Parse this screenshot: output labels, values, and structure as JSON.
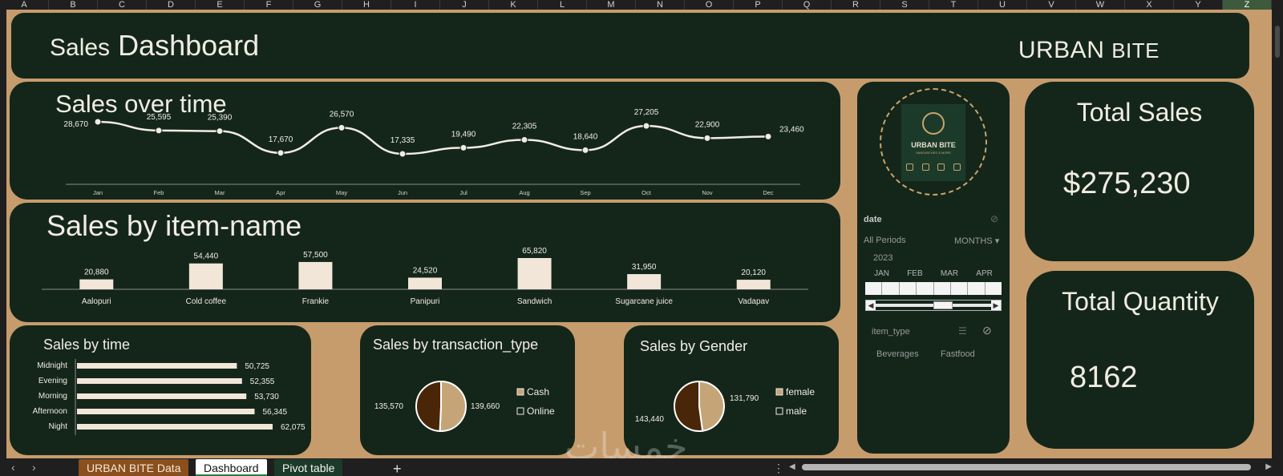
{
  "columns": [
    "A",
    "B",
    "C",
    "D",
    "E",
    "F",
    "G",
    "H",
    "I",
    "J",
    "K",
    "L",
    "M",
    "N",
    "O",
    "P",
    "Q",
    "R",
    "S",
    "T",
    "U",
    "V",
    "W",
    "X",
    "Y",
    "Z"
  ],
  "header": {
    "title_word_1": "Sales",
    "title_word_2": "Dashboard",
    "brand_word_1": "URBAN",
    "brand_word_2": "BITE"
  },
  "panels": {
    "sales_over_time": "Sales over time",
    "sales_by_item": "Sales by item-name",
    "sales_by_time": "Sales by time",
    "sales_by_transaction": "Sales by transaction_type",
    "sales_by_gender": "Sales by Gender"
  },
  "logo": {
    "name": "URBAN BITE",
    "tagline": "SANDWICHES & MORE"
  },
  "slicers": {
    "date": {
      "label": "date",
      "all_periods": "All Periods",
      "level": "MONTHS",
      "year": "2023",
      "months": [
        "JAN",
        "FEB",
        "MAR",
        "APR"
      ]
    },
    "item_type": {
      "label": "item_type",
      "items": [
        "Beverages",
        "Fastfood"
      ]
    }
  },
  "kpis": {
    "total_sales_label": "Total Sales",
    "total_sales_value": "$275,230",
    "total_quantity_label": "Total Quantity",
    "total_quantity_value": "8162"
  },
  "watermark": "خمسات",
  "sheet_tabs": [
    "URBAN BITE Data",
    "Dashboard",
    "Pivot table"
  ],
  "colors": {
    "panel_bg": "#14261a",
    "page_bg": "#c69c6d",
    "bar_fill": "#f1e6d8",
    "pie_dark": "#4a2608",
    "pie_light": "#c5a578"
  },
  "chart_data": [
    {
      "type": "line",
      "title": "Sales over time",
      "categories": [
        "Jan",
        "Feb",
        "Mar",
        "Apr",
        "May",
        "Jun",
        "Jul",
        "Aug",
        "Sep",
        "Oct",
        "Nov",
        "Dec"
      ],
      "values": [
        28670,
        25595,
        25390,
        17670,
        26570,
        17335,
        19490,
        22305,
        18640,
        27205,
        22900,
        23460
      ],
      "labels": [
        "28,670",
        "25,595",
        "25,390",
        "17,670",
        "26,570",
        "17,335",
        "19,490",
        "22,305",
        "18,640",
        "27,205",
        "22,900",
        "23,460"
      ]
    },
    {
      "type": "bar",
      "title": "Sales by item-name",
      "categories": [
        "Aalopuri",
        "Cold coffee",
        "Frankie",
        "Panipuri",
        "Sandwich",
        "Sugarcane juice",
        "Vadapav"
      ],
      "values": [
        20880,
        54440,
        57500,
        24520,
        65820,
        31950,
        20120
      ],
      "labels": [
        "20,880",
        "54,440",
        "57,500",
        "24,520",
        "65,820",
        "31,950",
        "20,120"
      ]
    },
    {
      "type": "bar",
      "title": "Sales by time",
      "orientation": "horizontal",
      "categories": [
        "Midnight",
        "Evening",
        "Morning",
        "Afternoon",
        "Night"
      ],
      "values": [
        50725,
        52355,
        53730,
        56345,
        62075
      ],
      "labels": [
        "50,725",
        "52,355",
        "53,730",
        "56,345",
        "62,075"
      ]
    },
    {
      "type": "pie",
      "title": "Sales by transaction_type",
      "categories": [
        "Cash",
        "Online"
      ],
      "values": [
        139660,
        135570
      ],
      "labels": [
        "139,660",
        "135,570"
      ]
    },
    {
      "type": "pie",
      "title": "Sales by Gender",
      "categories": [
        "female",
        "male"
      ],
      "values": [
        131790,
        143440
      ],
      "labels": [
        "131,790",
        "143,440"
      ]
    }
  ]
}
